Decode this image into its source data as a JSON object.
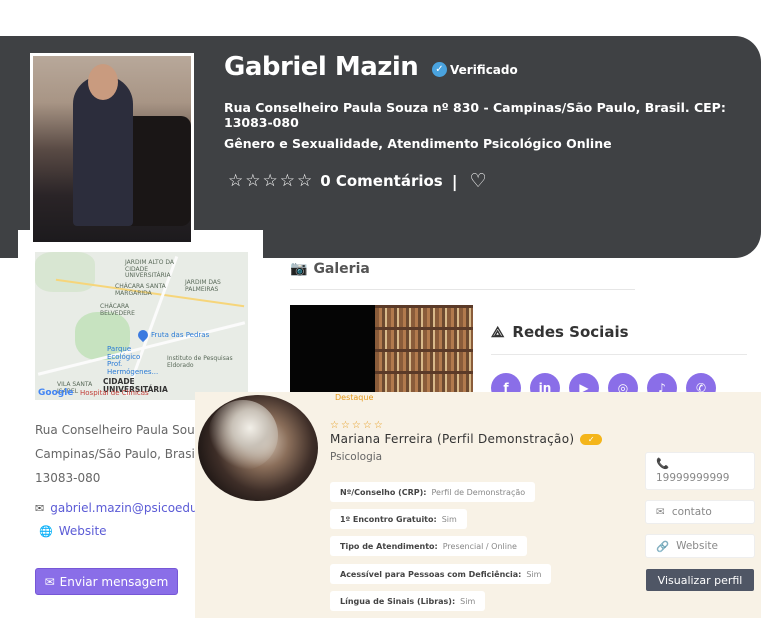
{
  "profile": {
    "name": "Gabriel Mazin",
    "verified_label": "Verificado",
    "address": "Rua Conselheiro Paula Souza nº 830 - Campinas/São Paulo, Brasil. CEP: 13083-080",
    "categories": "Gênero e Sexualidade,  Atendimento Psicológico Online",
    "stars": "☆☆☆☆☆",
    "comments": "0 Comentários",
    "separator": "|"
  },
  "map": {
    "labels": {
      "l1": "CHÁCARA SANTA MARGARIDA",
      "l2": "CHÁCARA BELVEDERE",
      "l3": "JARDIM ALTO DA CIDADE UNIVERSITÁRIA",
      "l4": "CHÁCARA SANTA MARGARIDA",
      "l5": "JARDIM DAS PALMEIRAS",
      "park": "Parque Ecológico Prof. Hermógenes...",
      "fruta": "Fruta das Pedras",
      "inst": "Instituto de Pesquisas Eldorado",
      "cidade": "CIDADE UNIVERSITÁRIA",
      "vila": "VILA SANTA ISABEL",
      "hosp": "Hospital de Clínicas",
      "google": "Google"
    }
  },
  "contact": {
    "address_line1": "Rua Conselheiro Paula Souza",
    "address_line2": "Campinas/São Paulo, Brasil. C",
    "address_line3": "13083-080",
    "email": "gabriel.mazin@psicoeduca",
    "website": "Website",
    "send_button": "Enviar mensagem"
  },
  "gallery": {
    "title": "Galeria"
  },
  "social": {
    "title": "Redes Sociais",
    "icons": [
      "facebook-icon",
      "linkedin-icon",
      "youtube-icon",
      "instagram-icon",
      "tiktok-icon",
      "whatsapp-icon"
    ]
  },
  "card": {
    "featured": "Destaque",
    "stars": "☆☆☆☆☆",
    "name": "Mariana Ferreira (Perfil Demonstração)",
    "badge": "✓",
    "specialty": "Psicologia",
    "fields": [
      {
        "label": "Nº/Conselho (CRP):",
        "value": "Perfil de Demonstração"
      },
      {
        "label": "1º Encontro Gratuito:",
        "value": "Sim"
      },
      {
        "label": "Tipo de Atendimento:",
        "value": "Presencial / Online"
      },
      {
        "label": "Acessível para Pessoas com Deficiência:",
        "value": "Sim"
      },
      {
        "label": "Língua de Sinais (Libras):",
        "value": "Sim"
      }
    ],
    "phone": "19999999999",
    "contact_label": "contato",
    "website_label": "Website",
    "view_button": "Visualizar perfil"
  },
  "colors": {
    "banner": "#3f4144",
    "accent": "#8a6ee8",
    "card_bg": "#f8f2e6",
    "badge": "#f4b51a"
  }
}
